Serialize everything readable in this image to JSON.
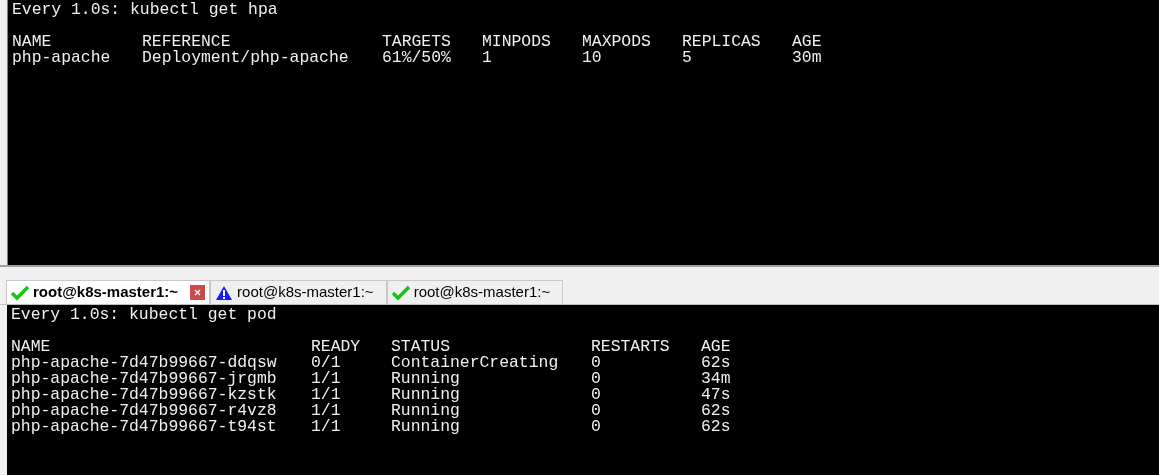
{
  "top_pane": {
    "command": "Every 1.0s: kubectl get hpa",
    "columns": [
      "NAME",
      "REFERENCE",
      "TARGETS",
      "MINPODS",
      "MAXPODS",
      "REPLICAS",
      "AGE"
    ],
    "rows": [
      [
        "php-apache",
        "Deployment/php-apache",
        "61%/50%",
        "1",
        "10",
        "5",
        "30m"
      ]
    ]
  },
  "tabs": [
    {
      "label": "root@k8s-master1:~",
      "selected": true,
      "kind": "ok"
    },
    {
      "label": "root@k8s-master1:~",
      "selected": false,
      "kind": "warning"
    },
    {
      "label": "root@k8s-master1:~",
      "selected": false,
      "kind": "ok"
    }
  ],
  "bottom_pane": {
    "command": "Every 1.0s: kubectl get pod",
    "columns": [
      "NAME",
      "READY",
      "STATUS",
      "RESTARTS",
      "AGE"
    ],
    "rows": [
      [
        "php-apache-7d47b99667-ddqsw",
        "0/1",
        "ContainerCreating",
        "0",
        "62s"
      ],
      [
        "php-apache-7d47b99667-jrgmb",
        "1/1",
        "Running",
        "0",
        "34m"
      ],
      [
        "php-apache-7d47b99667-kzstk",
        "1/1",
        "Running",
        "0",
        "47s"
      ],
      [
        "php-apache-7d47b99667-r4vz8",
        "1/1",
        "Running",
        "0",
        "62s"
      ],
      [
        "php-apache-7d47b99667-t94st",
        "1/1",
        "Running",
        "0",
        "62s"
      ]
    ]
  }
}
